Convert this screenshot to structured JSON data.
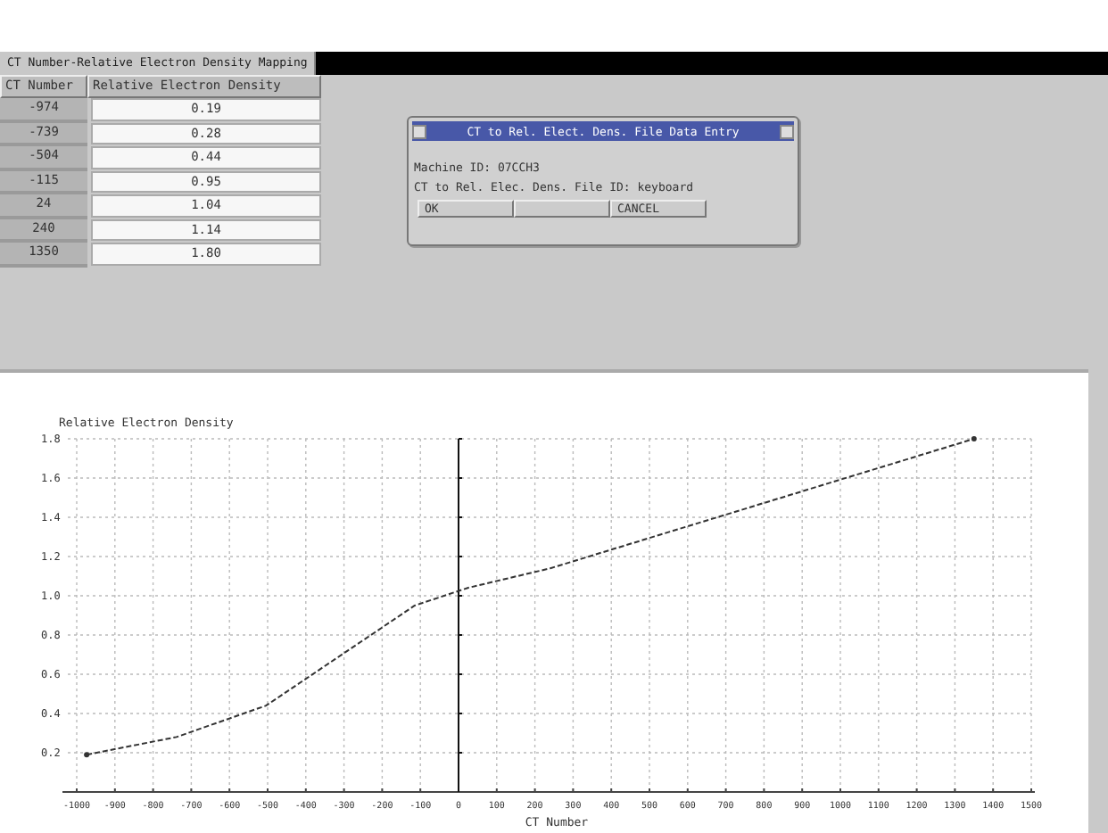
{
  "window": {
    "title": "CT Number-Relative Electron Density Mapping"
  },
  "table": {
    "columns": [
      "CT Number",
      "Relative Electron Density"
    ],
    "rows": [
      {
        "ct": "-974",
        "density": "0.19"
      },
      {
        "ct": "-739",
        "density": "0.28"
      },
      {
        "ct": "-504",
        "density": "0.44"
      },
      {
        "ct": "-115",
        "density": "0.95"
      },
      {
        "ct": "24",
        "density": "1.04"
      },
      {
        "ct": "240",
        "density": "1.14"
      },
      {
        "ct": "1350",
        "density": "1.80"
      }
    ]
  },
  "dialog": {
    "title": "CT to Rel. Elect. Dens. File Data Entry",
    "lines": [
      "Machine ID: 07CCH3",
      "CT to Rel. Elec. Dens. File ID: keyboard"
    ],
    "buttons": [
      {
        "kind": "button",
        "label": "OK"
      },
      {
        "kind": "blank"
      },
      {
        "kind": "button",
        "label": "CANCEL"
      }
    ]
  },
  "chart": {
    "chart_data": {
      "type": "line",
      "title": "Relative Electron Density",
      "xlabel": "CT Number",
      "grid": true,
      "x": [
        -974,
        -739,
        -504,
        -115,
        24,
        240,
        1350
      ],
      "series": [
        {
          "color": "#333333",
          "line_style": "dashed",
          "values": [
            0.19,
            0.28,
            0.44,
            0.95,
            1.04,
            1.14,
            1.8
          ]
        }
      ],
      "xlim": [
        -1000,
        1500
      ],
      "ylim": [
        0,
        1.8
      ],
      "xticks": [
        -1000,
        -900,
        -800,
        -700,
        -600,
        -500,
        -400,
        -300,
        -200,
        -100,
        0,
        100,
        200,
        300,
        400,
        500,
        600,
        700,
        800,
        900,
        1000,
        1100,
        1200,
        1300,
        1400,
        1500
      ],
      "yticks": [
        0.2,
        0.4,
        0.6,
        0.8,
        {
          "value": 1,
          "label": "1.0"
        },
        1.2,
        1.4,
        1.6,
        1.8
      ]
    }
  }
}
